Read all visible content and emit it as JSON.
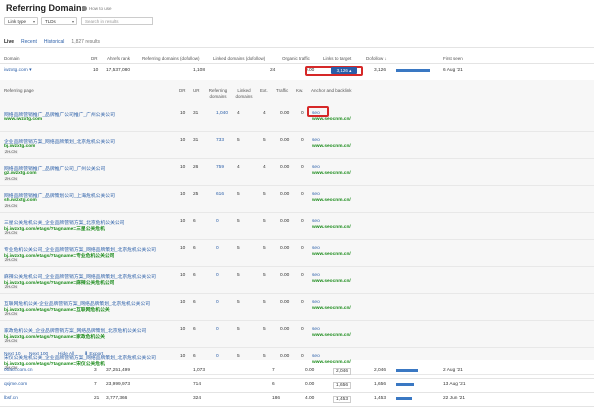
{
  "page": {
    "title": "Referring Domains",
    "howto": "How to use"
  },
  "filters": {
    "link_type": "Link type",
    "tlds": "TLDs",
    "search_placeholder": "Search in results"
  },
  "tabs": {
    "live": "Live",
    "recent": "Recent",
    "historical": "Historical",
    "count": "1,827 results"
  },
  "main_headers": {
    "domain": "Domain",
    "dr": "DR",
    "ahrefs_rank": "Ahrefs rank",
    "ref_domains": "Referring domains (dofollow)",
    "linked_domains": "Linked domains (dofollow)",
    "organic": "Organic traffic",
    "links_to_target": "Links to target",
    "dofollow": "Dofollow ↓",
    "first_seen": "First seen"
  },
  "top_row": {
    "domain": "iwzxtg.com",
    "dr": "10",
    "ahrefs_rank": "17,537,080",
    "ref_domains": "1,108",
    "linked_domains": "24",
    "organic": "0.00",
    "links_btn": "3,126",
    "dofollow": "3,126",
    "first_seen": "6 Aug '21",
    "bar_fraction": 1.0
  },
  "sub_headers": {
    "ref_page": "Referring page",
    "dr": "DR",
    "ur": "UR",
    "ref_domains": "Referring domains",
    "linked_domains": "Linked domains",
    "ext": "Ext.",
    "traffic": "Traffic",
    "kw": "Kw.",
    "anchor": "Anchor and backlink"
  },
  "sub_rows": [
    {
      "title": "网络品牌营销推广_品牌推广公司推广_广州公关公司",
      "url": "www.iwzxtg.com",
      "tag": "",
      "dr": "10",
      "ur": "31",
      "rd": "1,040",
      "ld": "4",
      "ext": "4",
      "traffic": "0.00",
      "kw": "0",
      "anchor": "seo",
      "backlink": "www.seocnm.cn/"
    },
    {
      "title": "企业品牌营销方案_网络品牌策划_北京危机公关公司",
      "url": "bj.iwzxtg.com",
      "tag": "ZH-CN",
      "dr": "10",
      "ur": "31",
      "rd": "733",
      "ld": "5",
      "ext": "5",
      "traffic": "0.00",
      "kw": "0",
      "anchor": "seo",
      "backlink": "www.seocnm.cn/"
    },
    {
      "title": "网络品牌营销推广_品牌推广公司_广州公关公司",
      "url": "gz.iwzxtg.com",
      "tag": "ZH-CN",
      "dr": "10",
      "ur": "26",
      "rd": "759",
      "ld": "4",
      "ext": "4",
      "traffic": "0.00",
      "kw": "0",
      "anchor": "seo",
      "backlink": "www.seocnm.cn/"
    },
    {
      "title": "网络品牌营销推广_品牌策划公司_上海危机公关公司",
      "url": "sh.iwzxtg.com",
      "tag": "ZH-CN",
      "dr": "10",
      "ur": "25",
      "rd": "616",
      "ld": "5",
      "ext": "5",
      "traffic": "0.00",
      "kw": "0",
      "anchor": "seo",
      "backlink": "www.seocnm.cn/"
    },
    {
      "title": "三星公关危机公关_企业品牌营销方案_北京危机公关公司",
      "url": "bj.iwzxtg.com/etags/?tagname=三星公关危机",
      "tag": "ZH-CN",
      "dr": "10",
      "ur": "6",
      "rd": "0",
      "ld": "5",
      "ext": "5",
      "traffic": "0.00",
      "kw": "0",
      "anchor": "seo",
      "backlink": "www.seocnm.cn/"
    },
    {
      "title": "专业危机公关公司_企业品牌营销方案_网络品牌策划_北京危机公关公司",
      "url": "bj.iwzxtg.com/etags/?tagname=专业危机公关公司",
      "tag": "ZH-CN",
      "dr": "10",
      "ur": "6",
      "rd": "0",
      "ld": "5",
      "ext": "5",
      "traffic": "0.00",
      "kw": "0",
      "anchor": "seo",
      "backlink": "www.seocnm.cn/"
    },
    {
      "title": "麻辣公关危机公司_企业品牌营销方案_网络品牌策划_北京危机公关公司",
      "url": "bj.iwzxtg.com/etags/?tagname=麻辣公关危机公司",
      "tag": "ZH-CN",
      "dr": "10",
      "ur": "6",
      "rd": "0",
      "ld": "5",
      "ext": "5",
      "traffic": "0.00",
      "kw": "0",
      "anchor": "seo",
      "backlink": "www.seocnm.cn/"
    },
    {
      "title": "互联网危机公关-企业品牌营销方案_网络品牌策划_北京危机公关公司",
      "url": "bj.iwzxtg.com/etags/?tagname=互联网危机公关",
      "tag": "ZH-CN",
      "dr": "10",
      "ur": "6",
      "rd": "0",
      "ld": "5",
      "ext": "5",
      "traffic": "0.00",
      "kw": "0",
      "anchor": "seo",
      "backlink": "www.seocnm.cn/"
    },
    {
      "title": "家政危机公关_企业品牌营销方案_网络品牌策划_北京危机公关公司",
      "url": "bj.iwzxtg.com/etags/?tagname=家政危机公关",
      "tag": "ZH-CN",
      "dr": "10",
      "ur": "6",
      "rd": "0",
      "ld": "5",
      "ext": "5",
      "traffic": "0.00",
      "kw": "0",
      "anchor": "seo",
      "backlink": "www.seocnm.cn/"
    },
    {
      "title": "宋仪公关危机公关_企业品牌营销方案_网络品牌策划_北京危机公关公司",
      "url": "bj.iwzxtg.com/etags/?tagname=宋仪公关危机",
      "tag": "ZH-CN",
      "dr": "10",
      "ur": "6",
      "rd": "0",
      "ld": "5",
      "ext": "5",
      "traffic": "0.00",
      "kw": "0",
      "anchor": "seo",
      "backlink": "www.seocnm.cn/"
    }
  ],
  "sub_footer": {
    "next10": "Next 10",
    "next100": "Next 100",
    "hide_all": "Hide All",
    "export": "Export"
  },
  "bottom_rows": [
    {
      "domain": "00act.com.cn",
      "dr": "3",
      "rank": "37,251,499",
      "rd": "1,073",
      "ld": "7",
      "organic": "0.00",
      "links": "2,046",
      "dofollow": "2,046",
      "first_seen": "2 Aug '21",
      "bar_fraction": 0.65
    },
    {
      "domain": "qxjme.com",
      "dr": "7",
      "rank": "23,999,973",
      "rd": "714",
      "ld": "6",
      "organic": "0.00",
      "links": "1,656",
      "dofollow": "1,656",
      "first_seen": "13 Aug '21",
      "bar_fraction": 0.53
    },
    {
      "domain": "lbsf.cn",
      "dr": "21",
      "rank": "3,777,366",
      "rd": "324",
      "ld": "186",
      "organic": "4.00",
      "links": "1,453",
      "dofollow": "1,453",
      "first_seen": "22 Jun '21",
      "bar_fraction": 0.46
    }
  ]
}
